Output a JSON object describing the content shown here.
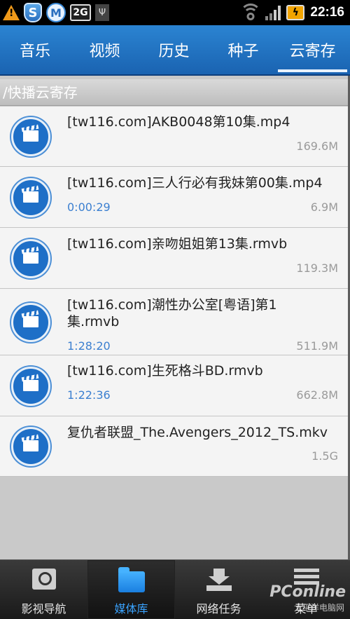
{
  "status_bar": {
    "time": "22:16",
    "sd_label": "2G",
    "icons": [
      "warning-icon",
      "shield-s-icon",
      "m-badge-icon",
      "sd-card-icon",
      "usb-icon",
      "wifi-icon",
      "signal-icon",
      "battery-charging-icon"
    ]
  },
  "tabs": [
    {
      "label": "音乐",
      "active": false
    },
    {
      "label": "视频",
      "active": false
    },
    {
      "label": "历史",
      "active": false
    },
    {
      "label": "种子",
      "active": false
    },
    {
      "label": "云寄存",
      "active": true
    }
  ],
  "path": "/快播云寄存",
  "files": [
    {
      "name": "[tw116.com]AKB0048第10集.mp4",
      "duration": "",
      "size": "169.6M"
    },
    {
      "name": "[tw116.com]三人行必有我妹第00集.mp4",
      "duration": "0:00:29",
      "size": "6.9M"
    },
    {
      "name": "[tw116.com]亲吻姐姐第13集.rmvb",
      "duration": "",
      "size": "119.3M"
    },
    {
      "name": "[tw116.com]潮性办公室[粤语]第1集.rmvb",
      "duration": "1:28:20",
      "size": "511.9M"
    },
    {
      "name": "[tw116.com]生死格斗BD.rmvb",
      "duration": "1:22:36",
      "size": "662.8M"
    },
    {
      "name": "复仇者联盟_The.Avengers_2012_TS.mkv",
      "duration": "",
      "size": "1.5G"
    }
  ],
  "bottom_nav": [
    {
      "label": "影视导航",
      "icon": "film-search-icon",
      "active": false
    },
    {
      "label": "媒体库",
      "icon": "folder-icon",
      "active": true
    },
    {
      "label": "网络任务",
      "icon": "download-icon",
      "active": false
    },
    {
      "label": "菜单",
      "icon": "menu-icon",
      "active": false
    }
  ],
  "watermark": {
    "brand": "PConline",
    "sub": "太平洋电脑网"
  },
  "colors": {
    "tab_bar": "#1a63b1",
    "duration": "#3b7fd0",
    "nav_active": "#3aa3ff"
  }
}
